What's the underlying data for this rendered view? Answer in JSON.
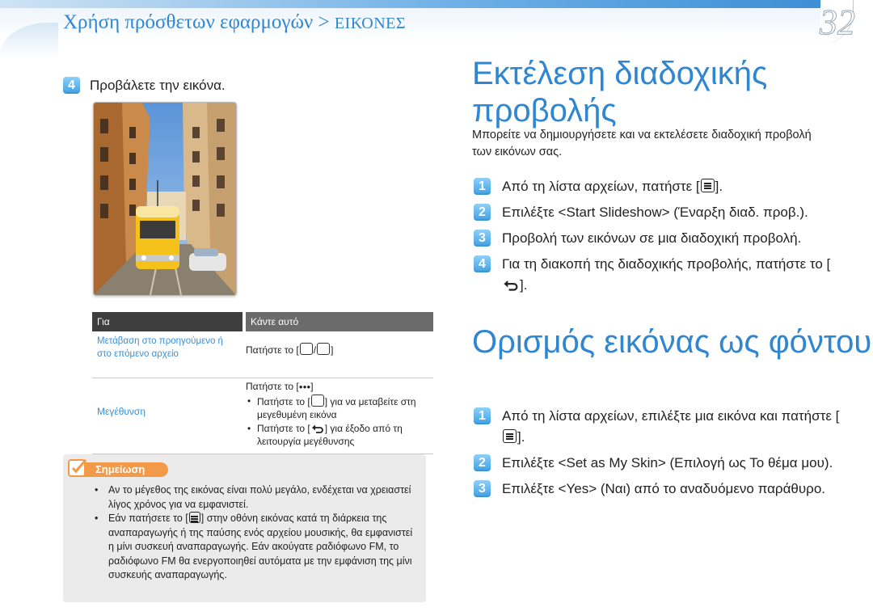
{
  "header": {
    "breadcrumb_main": "Χρήση πρόσθετων εφαρμογών > ",
    "breadcrumb_sub": "ΕΙΚΟΝΕΣ",
    "page_number": "32"
  },
  "left": {
    "view_step": {
      "number": "4",
      "text": "Προβάλετε την εικόνα."
    },
    "table": {
      "headers": [
        "Για",
        "Κάντε αυτό"
      ],
      "rows": [
        {
          "action": "Μετάβαση στο προηγούμενο ή στο επόμενο αρχείο",
          "how_prefix": "Πατήστε το [",
          "how_sep": "/",
          "how_suffix": "]"
        },
        {
          "action": "Μεγέθυνση",
          "line1_prefix": "Πατήστε το [",
          "line1_glyph": "●●●",
          "line1_suffix": "]",
          "bullet1_prefix": "Πατήστε το [",
          "bullet1_suffix": "] για να μεταβείτε στη μεγεθυμένη εικόνα",
          "bullet2_prefix": "Πατήστε το [",
          "bullet2_suffix": "] για έξοδο από τη λειτουργία μεγέθυνσης"
        }
      ]
    },
    "note": {
      "label": "Σημείωση",
      "items": [
        "Αν το μέγεθος της εικόνας είναι πολύ μεγάλο, ενδέχεται να χρειαστεί λίγος χρόνος για να εμφανιστεί.",
        "Εάν πατήσετε το [",
        "] στην οθόνη εικόνας κατά τη διάρκεια της αναπαραγωγής ή της παύσης ενός αρχείου μουσικής, θα εμφανιστεί η μίνι συσκευή αναπαραγωγής. Εάν ακούγατε ραδιόφωνο FM, το ραδιόφωνο FM θα ενεργοποιηθεί αυτόματα με την εμφάνιση της μίνι συσκευής αναπαραγωγής."
      ]
    }
  },
  "right": {
    "section1": {
      "title": "Εκτέλεση διαδοχικής προβολής",
      "intro": "Μπορείτε να δημιουργήσετε και να εκτελέσετε διαδοχική προβολή των εικόνων σας.",
      "steps": [
        {
          "number": "1",
          "text_before": "Από τη λίστα αρχείων, πατήστε [",
          "text_after": "]."
        },
        {
          "number": "2",
          "text": "Επιλέξτε <Start Slideshow> (Έναρξη διαδ. προβ.)."
        },
        {
          "number": "3",
          "text": "Προβολή των εικόνων σε μια διαδοχική προβολή."
        },
        {
          "number": "4",
          "text_before": "Για τη διακοπή της διαδοχικής προβολής, πατήστε το [",
          "text_after": "]."
        }
      ]
    },
    "section2": {
      "title": "Ορισμός εικόνας ως φόντου",
      "steps": [
        {
          "number": "1",
          "text_before": "Από τη λίστα αρχείων, επιλέξτε μια εικόνα και πατήστε [",
          "text_after": "]."
        },
        {
          "number": "2",
          "text": "Επιλέξτε <Set as My Skin> (Επιλογή ως Το θέμα μου)."
        },
        {
          "number": "3",
          "text": "Επιλέξτε <Yes> (Ναι) από το αναδυόμενο παράθυρο."
        }
      ]
    }
  },
  "colors": {
    "accent": "#2f86d1",
    "badge": "#3fa0e4",
    "note_label": "#f39a48",
    "table_header": "#3e3e3e"
  }
}
